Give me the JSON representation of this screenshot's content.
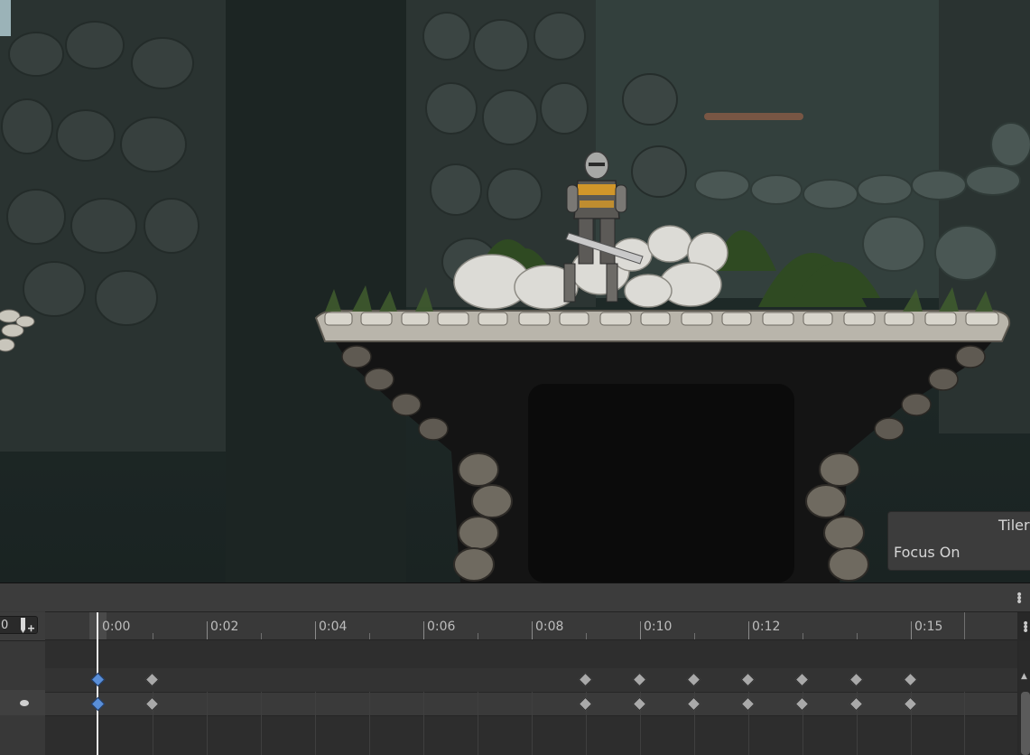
{
  "scene_panel": {
    "tiler_label": "Tiler",
    "focus_label": "Focus On"
  },
  "timeline": {
    "frame_value": "0",
    "ticks": [
      "0:00",
      "0:02",
      "0:04",
      "0:06",
      "0:08",
      "0:10",
      "0:12",
      "0:15"
    ],
    "icons": {
      "menu": "kebab-menu-icon",
      "add_keyframe": "add-keyframe-icon",
      "visibility": "eye-icon"
    },
    "colors": {
      "selected_keyframe": "#5a8fd8",
      "keyframe": "#a9a9a9"
    }
  }
}
